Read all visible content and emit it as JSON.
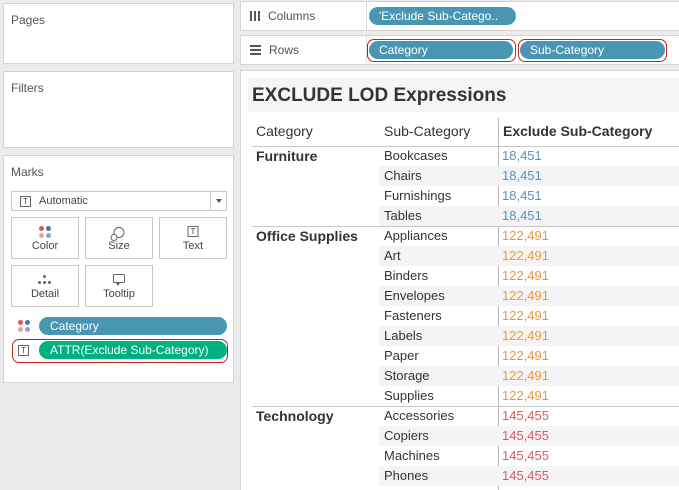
{
  "cards": {
    "pages_title": "Pages",
    "filters_title": "Filters",
    "marks_title": "Marks"
  },
  "marks": {
    "mark_type": "Automatic",
    "buttons": [
      {
        "label": "Color",
        "icon": "color-dots-icon"
      },
      {
        "label": "Size",
        "icon": "size-icon"
      },
      {
        "label": "Text",
        "icon": "text-icon"
      },
      {
        "label": "Detail",
        "icon": "detail-icon"
      },
      {
        "label": "Tooltip",
        "icon": "tooltip-icon"
      }
    ],
    "fields": [
      {
        "label": "Category",
        "encoding": "color-dots-icon",
        "color": "#4996b2"
      },
      {
        "label": "ATTR(Exclude Sub-Category)",
        "encoding": "text-icon",
        "color": "#00b180"
      }
    ]
  },
  "shelves": {
    "columns_label": "Columns",
    "rows_label": "Rows",
    "columns_pills": [
      "'Exclude Sub-Catego.."
    ],
    "rows_pills": [
      "Category",
      "Sub-Category"
    ]
  },
  "view": {
    "title": "EXCLUDE LOD Expressions",
    "headers": {
      "category": "Category",
      "sub_category": "Sub-Category",
      "measure": "Exclude Sub-Category"
    },
    "groups": [
      {
        "category": "Furniture",
        "color": "#5b8fc6",
        "rows": [
          {
            "sub": "Bookcases",
            "value": "18,451"
          },
          {
            "sub": "Chairs",
            "value": "18,451"
          },
          {
            "sub": "Furnishings",
            "value": "18,451"
          },
          {
            "sub": "Tables",
            "value": "18,451"
          }
        ]
      },
      {
        "category": "Office Supplies",
        "color": "#f0953a",
        "rows": [
          {
            "sub": "Appliances",
            "value": "122,491"
          },
          {
            "sub": "Art",
            "value": "122,491"
          },
          {
            "sub": "Binders",
            "value": "122,491"
          },
          {
            "sub": "Envelopes",
            "value": "122,491"
          },
          {
            "sub": "Fasteners",
            "value": "122,491"
          },
          {
            "sub": "Labels",
            "value": "122,491"
          },
          {
            "sub": "Paper",
            "value": "122,491"
          },
          {
            "sub": "Storage",
            "value": "122,491"
          },
          {
            "sub": "Supplies",
            "value": "122,491"
          }
        ]
      },
      {
        "category": "Technology",
        "color": "#e05a5a",
        "rows": [
          {
            "sub": "Accessories",
            "value": "145,455"
          },
          {
            "sub": "Copiers",
            "value": "145,455"
          },
          {
            "sub": "Machines",
            "value": "145,455"
          },
          {
            "sub": "Phones",
            "value": "145,455"
          }
        ]
      }
    ]
  }
}
